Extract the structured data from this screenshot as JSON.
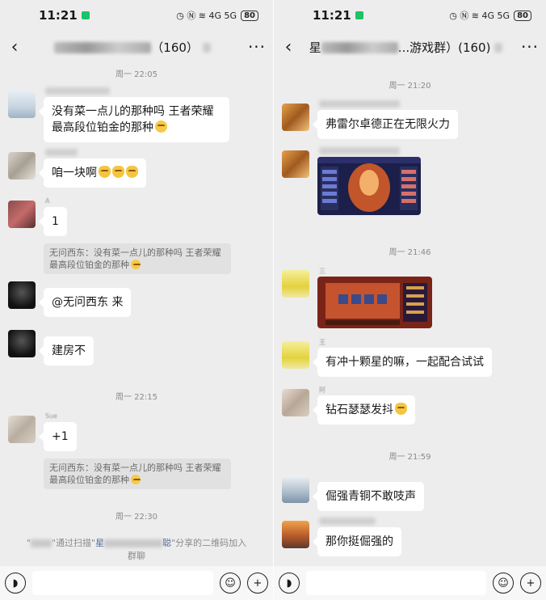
{
  "left": {
    "status": {
      "time": "11:21",
      "icons": "◷ Ⓝ ≋ 4G 5G",
      "battery": "80"
    },
    "header": {
      "title_suffix": "（160）",
      "more": "···",
      "back": "‹"
    },
    "messages": [
      {
        "type": "timestamp",
        "text": "周一 22:05"
      },
      {
        "type": "text",
        "nick": "",
        "text": "没有菜一点儿的那种吗 王者荣耀最高段位铂金的那种"
      },
      {
        "type": "text",
        "nick": "",
        "text": "咱一块啊"
      },
      {
        "type": "text",
        "nick": "A",
        "text": "1",
        "quote": "无问西东：没有菜一点儿的那种吗 王者荣耀最高段位铂金的那种"
      },
      {
        "type": "text",
        "nick": "",
        "text": "@无问西东  来"
      },
      {
        "type": "text",
        "nick": "",
        "text": "建房不"
      },
      {
        "type": "timestamp",
        "text": "周一 22:15"
      },
      {
        "type": "text",
        "nick": "Sue",
        "text": "+1",
        "quote": "无问西东：没有菜一点儿的那种吗 王者荣耀最高段位铂金的那种"
      },
      {
        "type": "timestamp",
        "text": "周一 22:30"
      },
      {
        "type": "system",
        "pre": "\"",
        "mid1": "\"通过扫描\"",
        "link1": "星",
        "mid2": "",
        "link2": "聪",
        "post": "\"分享的二维码加入群聊"
      }
    ]
  },
  "right": {
    "status": {
      "time": "11:21",
      "icons": "◷ Ⓝ ≋ 4G 5G",
      "battery": "80"
    },
    "header": {
      "title_prefix": "星",
      "title_suffix": "...游戏群）(160)",
      "more": "···",
      "back": "‹"
    },
    "messages": [
      {
        "type": "timestamp",
        "text": "周一 21:20"
      },
      {
        "type": "text",
        "text": "弗雷尔卓德正在无限火力"
      },
      {
        "type": "image",
        "name": "game-screenshot-1"
      },
      {
        "type": "timestamp",
        "text": "周一 21:46"
      },
      {
        "type": "image",
        "nick": "三",
        "name": "game-screenshot-2"
      },
      {
        "type": "text",
        "nick": "王",
        "text": "有冲十颗星的嘛，一起配合试试"
      },
      {
        "type": "text",
        "nick": "阿",
        "text": "钻石瑟瑟发抖"
      },
      {
        "type": "timestamp",
        "text": "周一 21:59"
      },
      {
        "type": "text",
        "text": "倔强青铜不敢吱声"
      },
      {
        "type": "text",
        "text": "那你挺倔强的"
      }
    ]
  },
  "input": {
    "voice_icon": "voice-icon",
    "emoji_icon": "emoji-icon",
    "plus_icon": "plus-icon"
  }
}
